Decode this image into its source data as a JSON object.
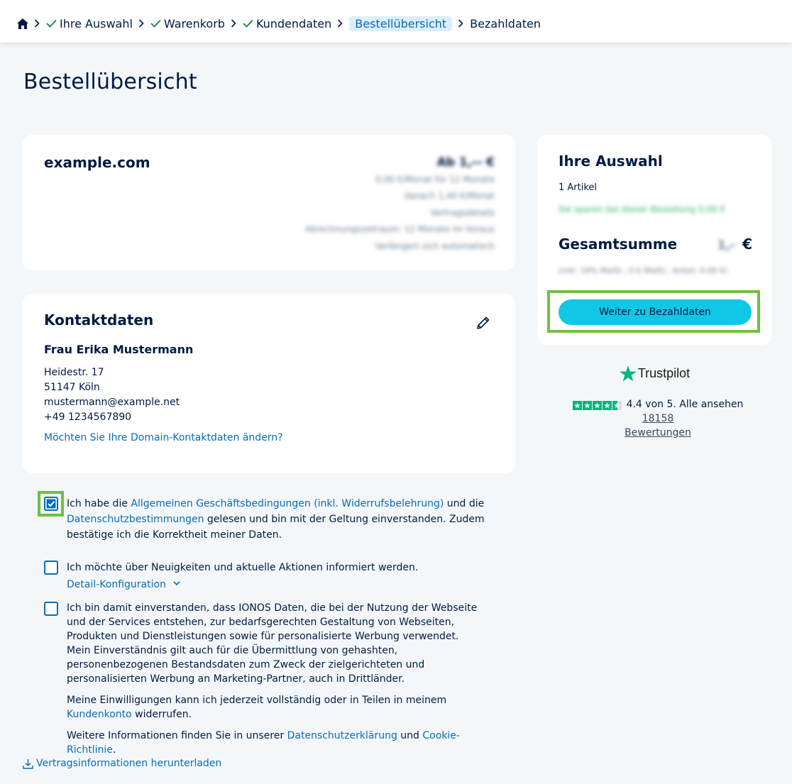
{
  "breadcrumb": {
    "home_icon": "home-icon",
    "items": [
      {
        "label": "Ihre Auswahl",
        "done": true
      },
      {
        "label": "Warenkorb",
        "done": true
      },
      {
        "label": "Kundendaten",
        "done": true
      },
      {
        "label": "Bestellübersicht",
        "current": true
      },
      {
        "label": "Bezahldaten"
      }
    ]
  },
  "page_title": "Bestellübersicht",
  "domain_card": {
    "title": "example.com",
    "price_lines": [
      "Ab 1,-- €",
      "0,00 €/Monat für 12 Monate",
      "danach 1,40 €/Monat",
      "Vertragsdetails",
      "Abrechnungszeitraum: 12 Monate im Voraus",
      "Verlängert sich automatisch"
    ]
  },
  "contact_card": {
    "title": "Kontaktdaten",
    "name": "Frau Erika Mustermann",
    "street": "Heidestr. 17",
    "city": "51147 Köln",
    "email": "mustermann@example.net",
    "phone": "+49 1234567890",
    "change_link": "Möchten Sie Ihre Domain-Kontaktdaten ändern?"
  },
  "summary": {
    "title": "Ihre Auswahl",
    "count": "1 Artikel",
    "savings": "Sie sparen bei dieser Bestellung 0,00 €",
    "total_label": "Gesamtsumme",
    "total_value": "1,-",
    "currency": "€",
    "vat_note": "(inkl. 19% MwSt., 0 € MwSt., Anteil: 0,00 €)",
    "button": "Weiter zu Bezahldaten"
  },
  "trustpilot": {
    "brand": "Trustpilot",
    "rating_text": "4.4 von 5. Alle ansehen",
    "reviews_count": "18158",
    "reviews_label": "Bewertungen",
    "score": 4.4
  },
  "consents": {
    "agb": {
      "checked": true,
      "t1": "Ich habe die ",
      "link1": "Allgemeinen Geschäftsbedingungen (inkl. Widerrufsbelehrung)",
      "t2": " und die ",
      "link2": "Datenschutzbestimmungen",
      "t3": " gelesen und bin mit der Geltung einverstanden. Zudem bestätige ich die Korrektheit meiner Daten."
    },
    "newsletter": {
      "checked": false,
      "text": "Ich möchte über Neuigkeiten und aktuelle Aktionen informiert werden.",
      "detail": "Detail-Konfiguration"
    },
    "data": {
      "checked": false,
      "p1": "Ich bin damit einverstanden, dass IONOS Daten, die bei der Nutzung der Webseite und der Services entstehen, zur bedarfsgerechten Gestaltung von Webseiten, Produkten und Dienstleistungen sowie für personalisierte Werbung verwendet. Mein Einverständnis gilt auch für die Übermittlung von gehashten, personenbezogenen Bestandsdaten zum Zweck der zielgerichteten und personalisierten Werbung an Marketing-Partner, auch in Drittländer.",
      "p2a": "Meine Einwilligungen kann ich jederzeit vollständig oder in Teilen in meinem ",
      "p2link": "Kundenkonto",
      "p2b": " widerrufen.",
      "p3a": "Weitere Informationen finden Sie in unserer ",
      "p3link1": "Datenschutzerklärung",
      "p3b": " und ",
      "p3link2": "Cookie-Richtlinie",
      "p3c": "."
    }
  },
  "download": "Vertragsinformationen herunterladen"
}
